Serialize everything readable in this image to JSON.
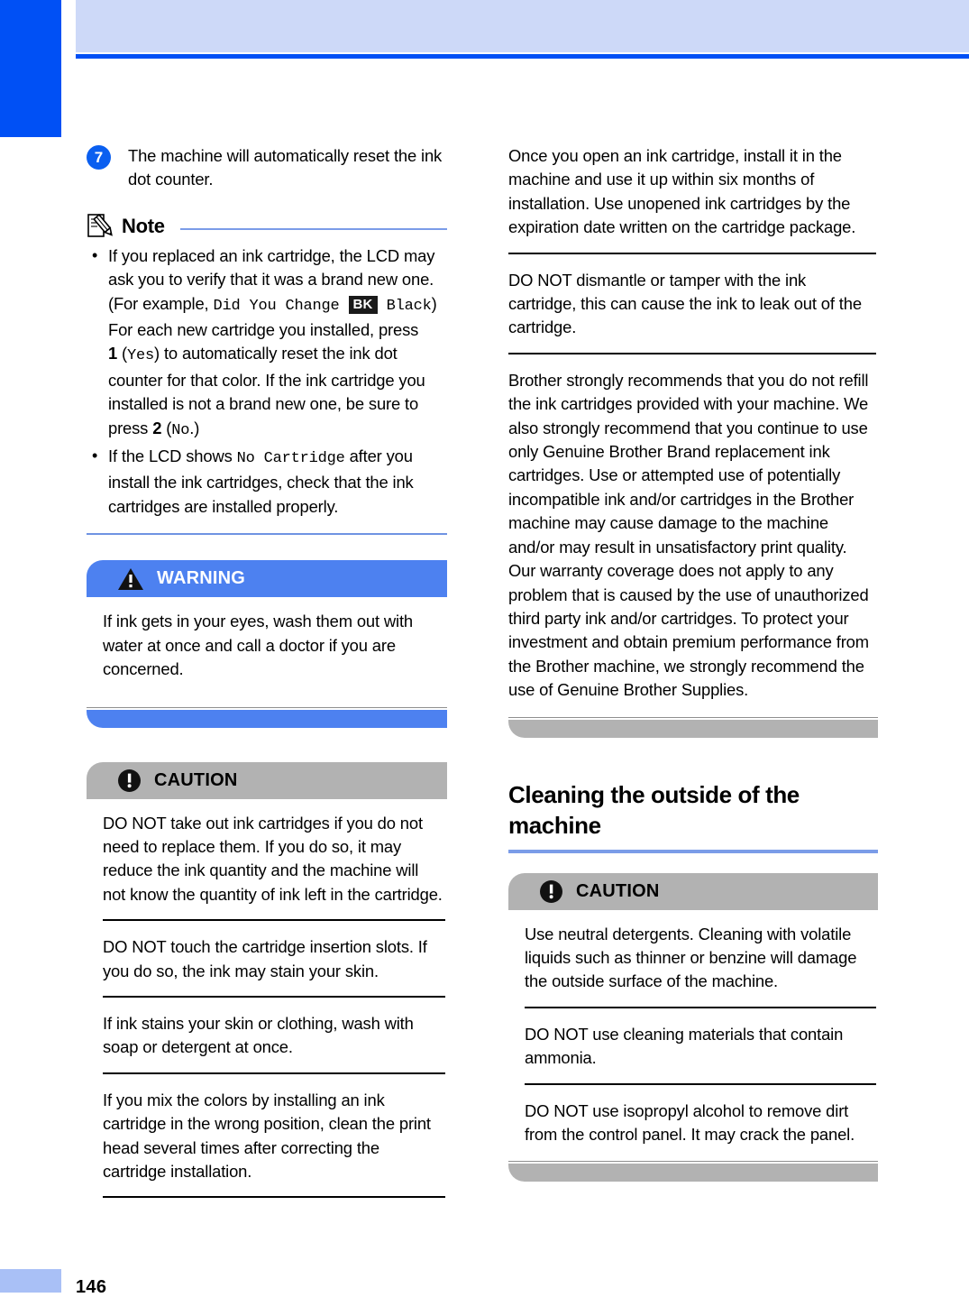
{
  "page": {
    "number": "146",
    "accent_blue": "#0050f5",
    "header_band_color": "#cdd9f8",
    "warning_color": "#4d81f0",
    "caution_color": "#b2b2b2",
    "note_rule_color": "#7b9ce8"
  },
  "left_column": {
    "step": {
      "number": "7",
      "text": "The machine will automatically reset the ink dot counter."
    },
    "note": {
      "title": "Note",
      "icon": "note-pencil-icon",
      "items": [
        {
          "part1": "If you replaced an ink cartridge, the LCD may ask you to verify that it was a brand new one. (For example, ",
          "lcd1": "Did You Change",
          "chip": "BK",
          "lcd2": "Black",
          "part2": ") For each new cartridge you installed, press ",
          "key1": "1",
          "key1_paren": "(",
          "lcd3": "Yes",
          "key1_paren_close": ")",
          "part3": " to automatically reset the ink dot counter for that color. If the ink cartridge you installed is not a brand new one, be sure to press ",
          "key2": "2",
          "lcd4": "No",
          "part4": "."
        },
        {
          "part1": "If the LCD shows ",
          "lcd1": "No Cartridge",
          "part2": " after you install the ink cartridges, check that the ink cartridges are installed properly."
        }
      ]
    },
    "warning": {
      "label": "WARNING",
      "icon": "warning-triangle-icon",
      "paragraphs": [
        "If ink gets in your eyes, wash them out with water at once and call a doctor if you are concerned."
      ]
    },
    "caution": {
      "label": "CAUTION",
      "icon": "caution-circle-icon",
      "paragraphs": [
        "DO NOT take out ink cartridges if you do not need to replace them. If you do so, it may reduce the ink quantity and the machine will not know the quantity of ink left in the cartridge.",
        "DO NOT touch the cartridge insertion slots. If you do so, the ink may stain your skin.",
        "If ink stains your skin or clothing, wash with soap or detergent at once.",
        "If you mix the colors by installing an ink cartridge in the wrong position, clean the print head several times after correcting the cartridge installation."
      ]
    }
  },
  "right_column": {
    "caution_continued": {
      "paragraphs": [
        "Once you open an ink cartridge, install it in the machine and use it up within six months of installation. Use unopened ink cartridges by the expiration date written on the cartridge package.",
        "DO NOT dismantle or tamper with the ink cartridge, this can cause the ink to leak out of the cartridge.",
        "Brother strongly recommends that you do not refill the ink cartridges provided with your machine. We also strongly recommend that you continue to use only Genuine Brother Brand replacement ink cartridges. Use or attempted use of potentially incompatible ink and/or cartridges in the Brother machine may cause damage to the machine and/or may result in unsatisfactory print quality. Our warranty coverage does not apply to any problem that is caused by the use of unauthorized third party ink and/or cartridges. To protect your investment and obtain premium performance from the Brother machine, we strongly recommend the use of Genuine Brother Supplies."
      ]
    },
    "section": {
      "heading": "Cleaning the outside of the machine"
    },
    "caution": {
      "label": "CAUTION",
      "icon": "caution-circle-icon",
      "paragraphs": [
        "Use neutral detergents. Cleaning with volatile liquids such as thinner or benzine will damage the outside surface of the machine.",
        "DO NOT use cleaning materials that contain ammonia.",
        "DO NOT use isopropyl alcohol to remove dirt from the control panel. It may crack the panel."
      ]
    }
  }
}
